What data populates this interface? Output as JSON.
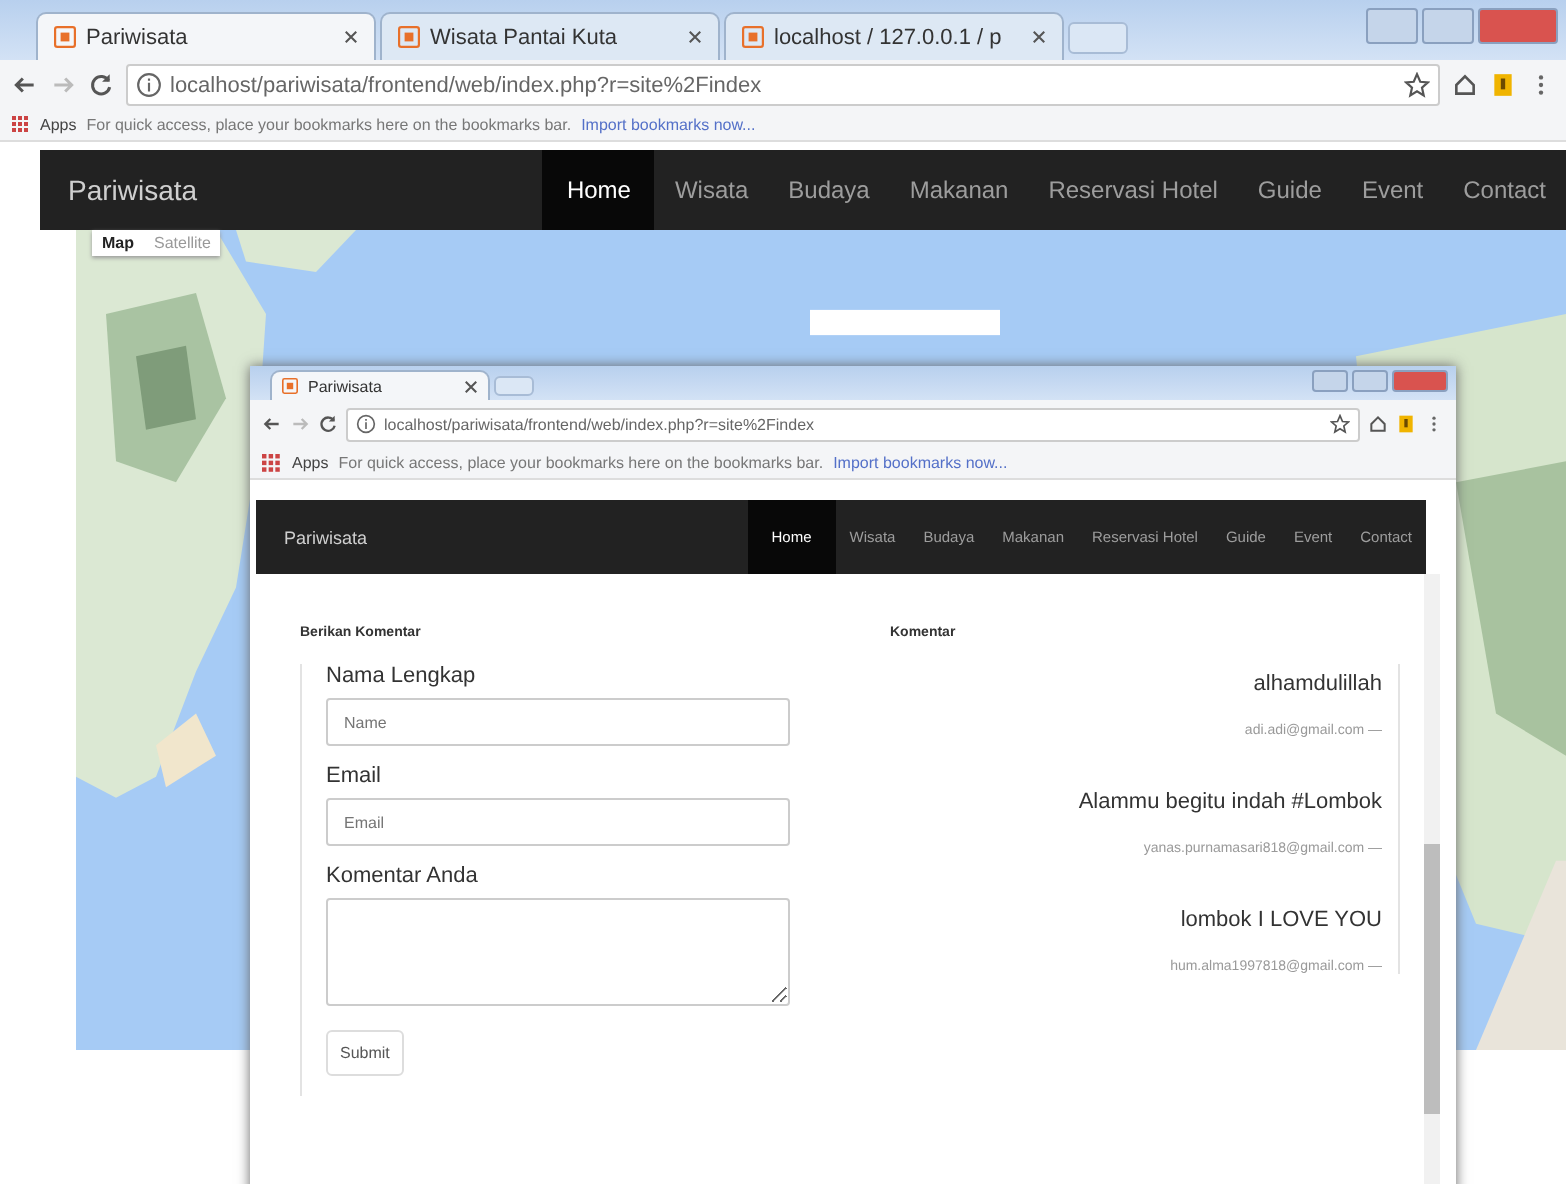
{
  "outer_window": {
    "tabs": [
      {
        "label": "Pariwisata",
        "selected": true
      },
      {
        "label": "Wisata Pantai Kuta",
        "selected": false
      },
      {
        "label": "localhost / 127.0.0.1 / p",
        "selected": false
      }
    ],
    "address": "localhost/pariwisata/frontend/web/index.php?r=site%2Findex",
    "bookmarks_bar": {
      "apps": "Apps",
      "hint": "For quick access, place your bookmarks here on the bookmarks bar.",
      "link": "Import bookmarks now..."
    },
    "navbar": {
      "brand": "Pariwisata",
      "items": [
        {
          "label": "Home",
          "selected": true
        },
        {
          "label": "Wisata",
          "selected": false
        },
        {
          "label": "Budaya",
          "selected": false
        },
        {
          "label": "Makanan",
          "selected": false
        },
        {
          "label": "Reservasi Hotel",
          "selected": false
        },
        {
          "label": "Guide",
          "selected": false
        },
        {
          "label": "Event",
          "selected": false
        },
        {
          "label": "Contact",
          "selected": false
        }
      ]
    },
    "map": {
      "kind": "picture",
      "type_buttons": [
        {
          "label": "Map",
          "selected": true
        },
        {
          "label": "Satellite",
          "selected": false
        }
      ]
    }
  },
  "inner_window": {
    "tabs": [
      {
        "label": "Pariwisata",
        "selected": true
      }
    ],
    "address": "localhost/pariwisata/frontend/web/index.php?r=site%2Findex",
    "bookmarks_bar": {
      "apps": "Apps",
      "hint": "For quick access, place your bookmarks here on the bookmarks bar.",
      "link": "Import bookmarks now..."
    },
    "navbar": {
      "brand": "Pariwisata",
      "items": [
        {
          "label": "Home",
          "selected": true
        },
        {
          "label": "Wisata",
          "selected": false
        },
        {
          "label": "Budaya",
          "selected": false
        },
        {
          "label": "Makanan",
          "selected": false
        },
        {
          "label": "Reservasi Hotel",
          "selected": false
        },
        {
          "label": "Guide",
          "selected": false
        },
        {
          "label": "Event",
          "selected": false
        },
        {
          "label": "Contact",
          "selected": false
        }
      ]
    },
    "form": {
      "heading": "Berikan Komentar",
      "fields": [
        {
          "label": "Nama Lengkap",
          "placeholder": "Name",
          "kind": "input"
        },
        {
          "label": "Email",
          "placeholder": "Email",
          "kind": "input"
        },
        {
          "label": "Komentar Anda",
          "kind": "textarea"
        }
      ],
      "submit": "Submit"
    },
    "comments": {
      "heading": "Komentar",
      "items": [
        {
          "text": "alhamdulillah",
          "author": "adi.adi@gmail.com —"
        },
        {
          "text": "Alammu begitu indah #Lombok",
          "author": "yanas.purnamasari818@gmail.com —"
        },
        {
          "text": "lombok I LOVE YOU",
          "author": "hum.alma1997818@gmail.com —"
        }
      ]
    }
  }
}
